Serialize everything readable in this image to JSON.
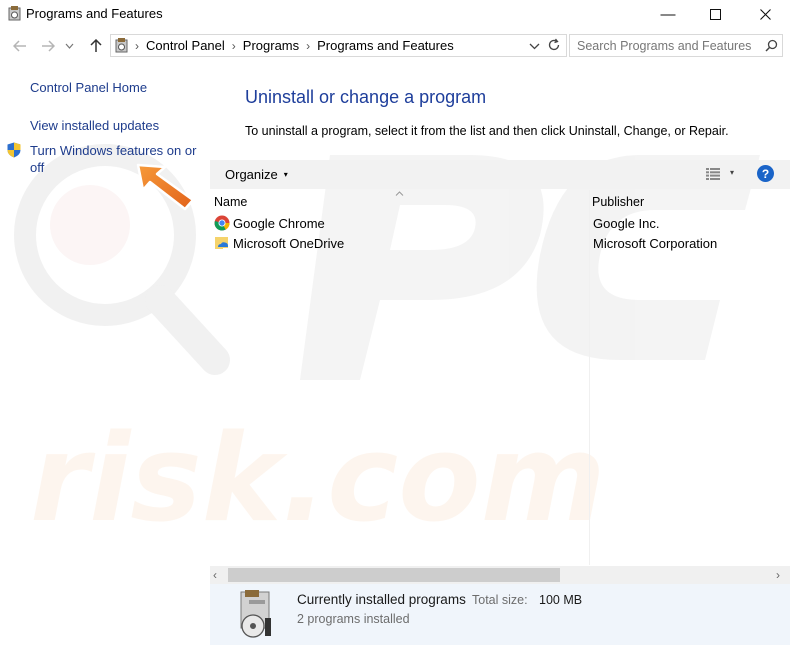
{
  "window": {
    "title": "Programs and Features",
    "minimize": "—",
    "maximize": "☐",
    "close": "✕"
  },
  "nav": {
    "back": "←",
    "forward": "→",
    "recent": "⌄",
    "up": "↑"
  },
  "address": {
    "crumbs": [
      "Control Panel",
      "Programs",
      "Programs and Features"
    ],
    "separator": "›",
    "dropdown": "⌄",
    "refresh": "↻"
  },
  "search": {
    "placeholder": "Search Programs and Features"
  },
  "left_pane": {
    "home": "Control Panel Home",
    "updates": "View installed updates",
    "features_line1": "Turn Windows features on or",
    "features_line2": "off"
  },
  "main": {
    "heading": "Uninstall or change a program",
    "description": "To uninstall a program, select it from the list and then click Uninstall, Change, or Repair."
  },
  "toolbar": {
    "organize": "Organize",
    "organize_caret": "▾",
    "view_caret": "▾",
    "help": "?"
  },
  "table": {
    "columns": [
      "Name",
      "Publisher"
    ],
    "rows": [
      {
        "name": "Google Chrome",
        "publisher": "Google Inc.",
        "icon": "chrome-icon"
      },
      {
        "name": "Microsoft OneDrive",
        "publisher": "Microsoft Corporation",
        "icon": "onedrive-icon"
      }
    ]
  },
  "scrollbar": {
    "left": "‹",
    "right": "›"
  },
  "details": {
    "title": "Currently installed programs",
    "size_label": "Total size:",
    "size_value": "100 MB",
    "count": "2 programs installed"
  },
  "colors": {
    "link": "#1e3c8c",
    "heading": "#1e3e9b",
    "arrow": "#f07a1e",
    "details_bg": "#f0f5fb"
  }
}
